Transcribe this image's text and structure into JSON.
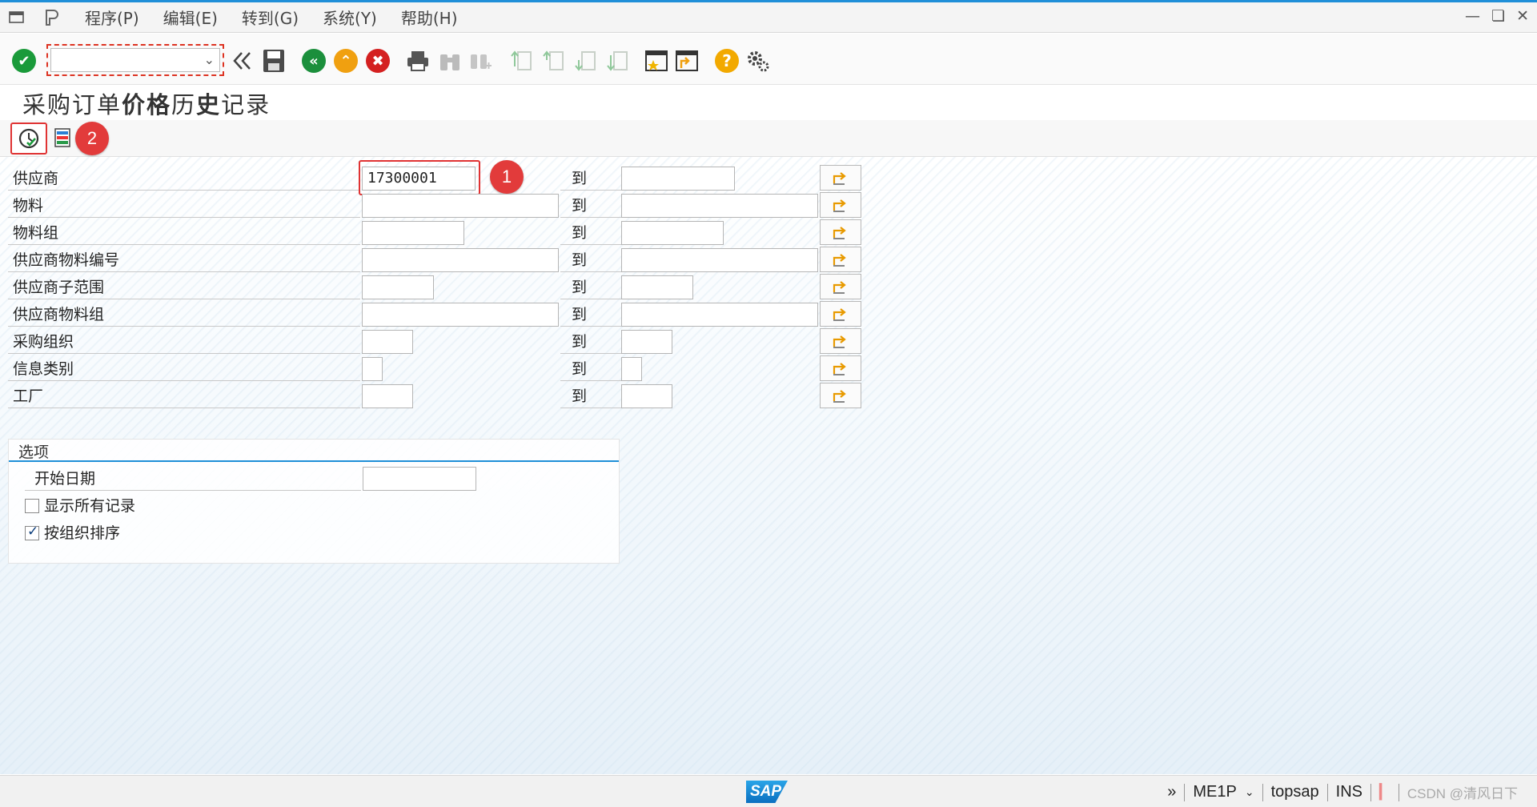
{
  "menu": {
    "items": [
      "程序(P)",
      "编辑(E)",
      "转到(G)",
      "系统(Y)",
      "帮助(H)"
    ]
  },
  "title": {
    "part1": "采购订单",
    "part2": "价格",
    "part3": "历",
    "part4": "史",
    "part5": "记录"
  },
  "badges": {
    "b1": "1",
    "b2": "2"
  },
  "selection": {
    "to_label": "到",
    "rows": [
      {
        "label": "供应商",
        "value": "17300001"
      },
      {
        "label": "物料",
        "value": ""
      },
      {
        "label": "物料组",
        "value": ""
      },
      {
        "label": "供应商物料编号",
        "value": ""
      },
      {
        "label": "供应商子范围",
        "value": ""
      },
      {
        "label": "供应商物料组",
        "value": ""
      },
      {
        "label": "采购组织",
        "value": ""
      },
      {
        "label": "信息类别",
        "value": ""
      },
      {
        "label": "工厂",
        "value": ""
      }
    ]
  },
  "options": {
    "title": "选项",
    "start_date_label": "开始日期",
    "show_all_label": "显示所有记录",
    "show_all_checked": false,
    "sort_by_org_label": "按组织排序",
    "sort_by_org_checked": true
  },
  "status": {
    "sap_logo": "SAP",
    "transaction": "ME1P",
    "user": "topsap",
    "mode": "INS",
    "watermark": "CSDN @清风日下"
  },
  "colors": {
    "accent": "#1f8fd8",
    "highlight": "#e03333"
  }
}
